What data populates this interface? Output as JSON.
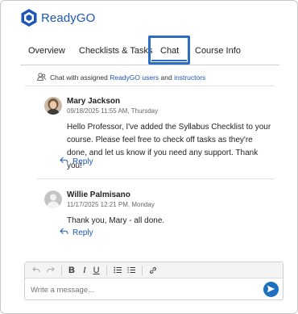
{
  "brand": {
    "name": "ReadyGO",
    "color": "#1e56b5"
  },
  "tabs": [
    {
      "label": "Overview",
      "active": false
    },
    {
      "label": "Checklists & Tasks",
      "active": false
    },
    {
      "label": "Chat",
      "active": true
    },
    {
      "label": "Course Info",
      "active": false
    }
  ],
  "info": {
    "prefix": "Chat with assigned",
    "link1": "ReadyGO users",
    "middle": "and",
    "link2": "instructors"
  },
  "messages": [
    {
      "author": "Mary Jackson",
      "timestamp": "09/18/2025 11:55 AM, Thursday",
      "body": "Hello Professor, I've added the Syllabus Checklist to your course. Please feel free to check off tasks as they're done, and let us know if you need any support. Thank you!",
      "reply_label": "Reply",
      "avatar": "photo"
    },
    {
      "author": "Willie Palmisano",
      "timestamp": "11/17/2025 12:21 PM, Monday",
      "body": "Thank you, Mary - all done.",
      "reply_label": "Reply",
      "avatar": "placeholder"
    }
  ],
  "composer": {
    "placeholder": "Write a message...",
    "toolbar": [
      "undo-icon",
      "redo-icon",
      "bold-icon",
      "italic-icon",
      "underline-icon",
      "bullet-list-icon",
      "numbered-list-icon",
      "link-icon"
    ],
    "bold": "B",
    "italic": "I",
    "underline": "U"
  },
  "colors": {
    "accent": "#2b6cc4",
    "send": "#1f6fc0"
  }
}
